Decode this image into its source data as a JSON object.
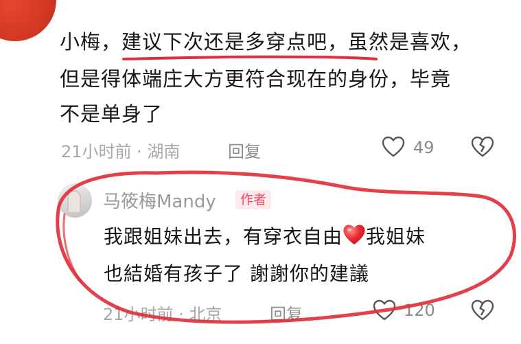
{
  "comment": {
    "lines": [
      "小梅，建议下次还是多穿点吧，虽然是喜欢，",
      "但是得体端庄大方更符合现在的身份，毕竟",
      "不是单身了"
    ],
    "time_location": "21小时前 · 湖南",
    "reply_label": "回复",
    "like_count": "49"
  },
  "reply": {
    "username": "马筱梅Mandy",
    "badge": "作者",
    "line1_before": "我跟姐妹出去，有穿衣自由",
    "line1_after": "我姐妹",
    "line2": "也結婚有孩子了 謝謝你的建議",
    "time_location": "21小时前 · 北京",
    "reply_label": "回复",
    "like_count": "120"
  },
  "icons": {
    "like": "heart-outline-icon",
    "dislike": "broken-heart-icon",
    "emoji": "red-heart-emoji"
  },
  "colors": {
    "annotation_red": "#e0303b",
    "badge_text": "#f04a5d",
    "badge_bg": "#fdeaec",
    "meta_gray": "#a7a7a7"
  }
}
